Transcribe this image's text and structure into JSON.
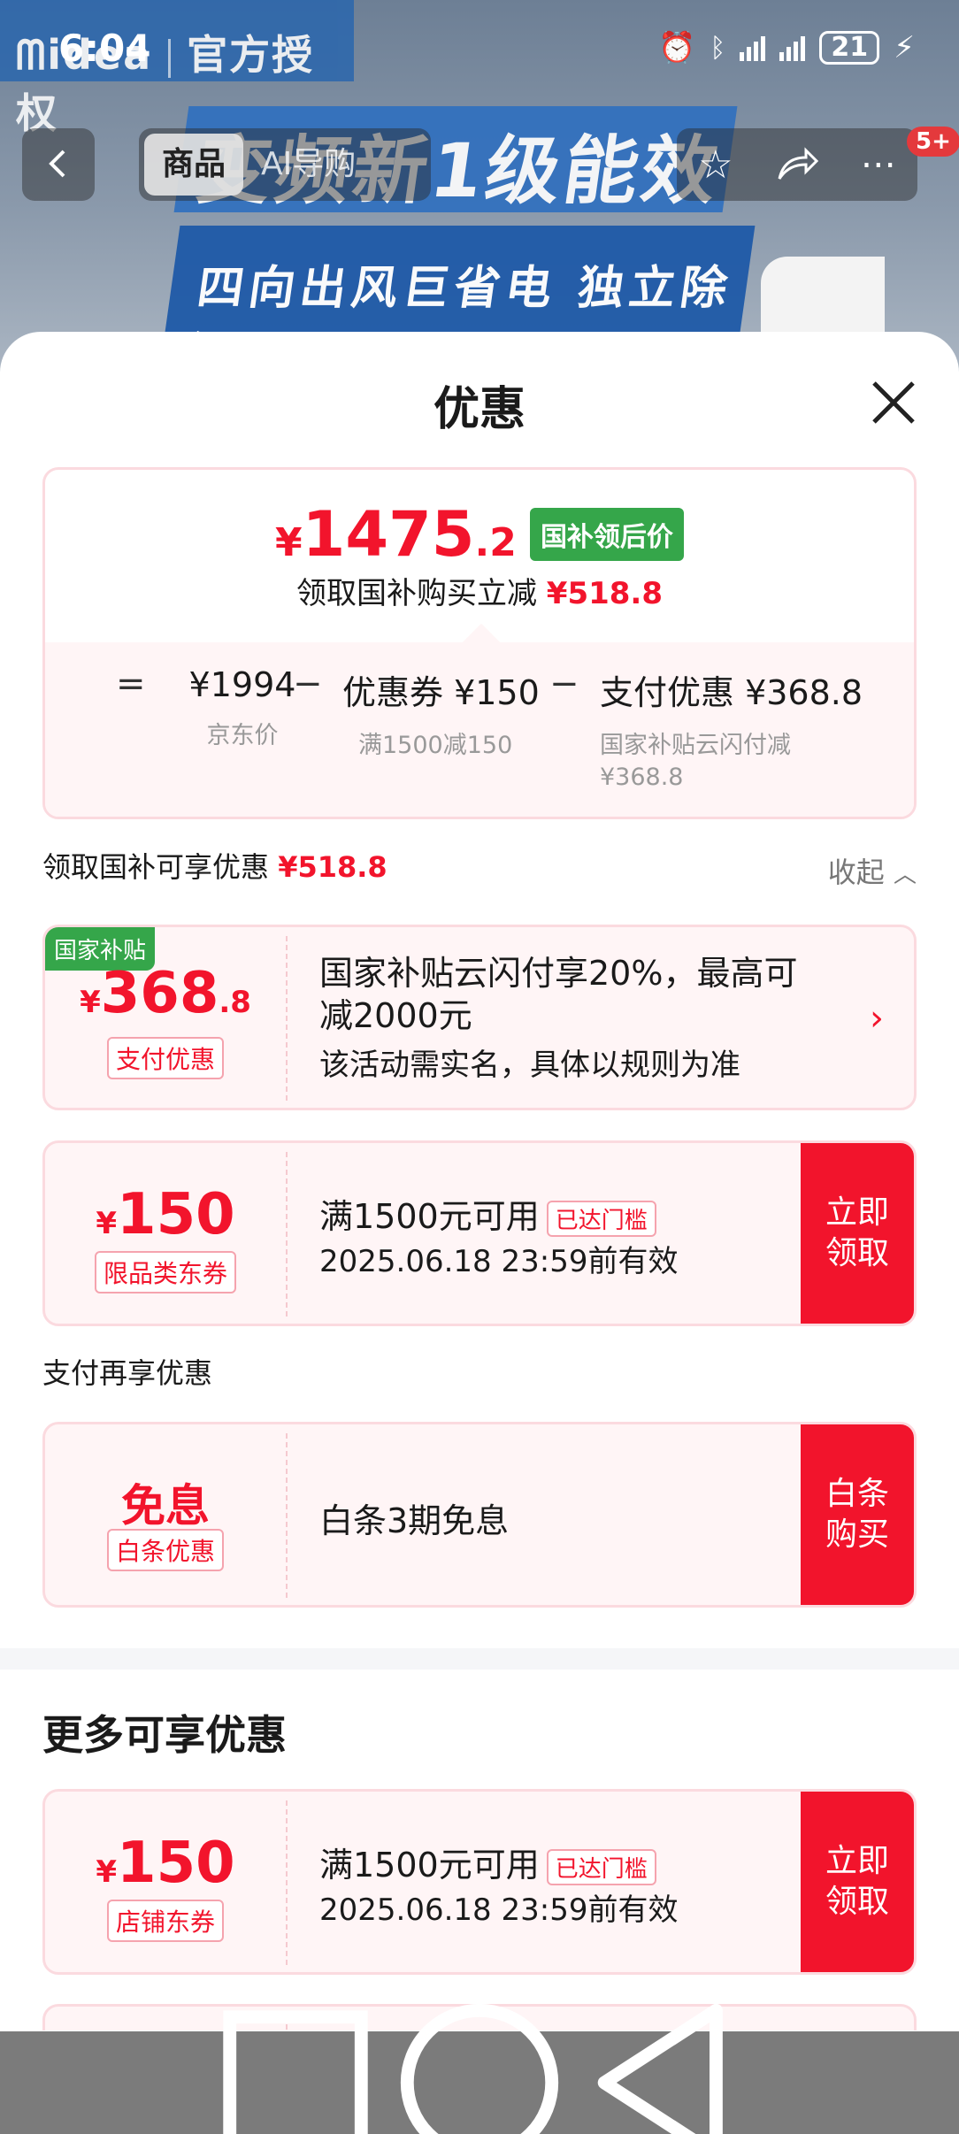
{
  "status_bar": {
    "time": "6:04",
    "battery": "21"
  },
  "background": {
    "brand_left": "ᗰidea",
    "brand_right": "官方授权",
    "promo_line1": "变频新1级能效",
    "promo_line2": "四向出风巨省电 独立除湿"
  },
  "nav": {
    "back_icon": "chevron-left-icon",
    "tabs": [
      {
        "label": "商品",
        "active": true
      },
      {
        "label": "AI导购",
        "active": false
      }
    ],
    "badge": "5+"
  },
  "sheet": {
    "title": "优惠",
    "summary": {
      "price_yen": "¥",
      "price_int": "1475",
      "price_dec": ".2",
      "price_tag": "国补领后价",
      "sub_text": "领取国补购买立减",
      "sub_amount": "¥518.8",
      "calc": {
        "equals": "=",
        "jd_price": "¥1994",
        "jd_label": "京东价",
        "minus1": "−",
        "coupon": "优惠券 ¥150",
        "coupon_label": "满1500减150",
        "minus2": "−",
        "payment": "支付优惠 ¥368.8",
        "payment_label_1": "国家补贴云闪付减",
        "payment_label_2": "¥368.8"
      }
    },
    "section1": {
      "label": "领取国补可享优惠",
      "amount": "¥518.8",
      "collapse": "收起"
    },
    "gov_card": {
      "tag": "国家补贴",
      "yen": "¥",
      "int": "368",
      "dec": ".8",
      "badge": "支付优惠",
      "desc1": "国家补贴云闪付享20%，最高可减2000元",
      "desc2": "该活动需实名，具体以规则为准"
    },
    "coupon1": {
      "yen": "¥",
      "int": "150",
      "badge": "限品类东券",
      "main": "满1500元可用",
      "chip": "已达门槛",
      "date": "2025.06.18 23:59前有效",
      "action_1": "立即",
      "action_2": "领取"
    },
    "section2": {
      "label": "支付再享优惠"
    },
    "baitiao_card": {
      "title": "免息",
      "badge": "白条优惠",
      "main": "白条3期免息",
      "action_1": "白条",
      "action_2": "购买"
    },
    "more_title": "更多可享优惠",
    "coupon2": {
      "yen": "¥",
      "int": "150",
      "badge": "店铺东券",
      "main": "满1500元可用",
      "chip": "已达门槛",
      "date": "2025.06.18 23:59前有效",
      "action_1": "立即",
      "action_2": "领取"
    }
  },
  "colors": {
    "accent_red": "#f2142c",
    "gov_green": "#35a64a",
    "card_bg": "#fff5f6",
    "card_border": "#fbdadf"
  }
}
